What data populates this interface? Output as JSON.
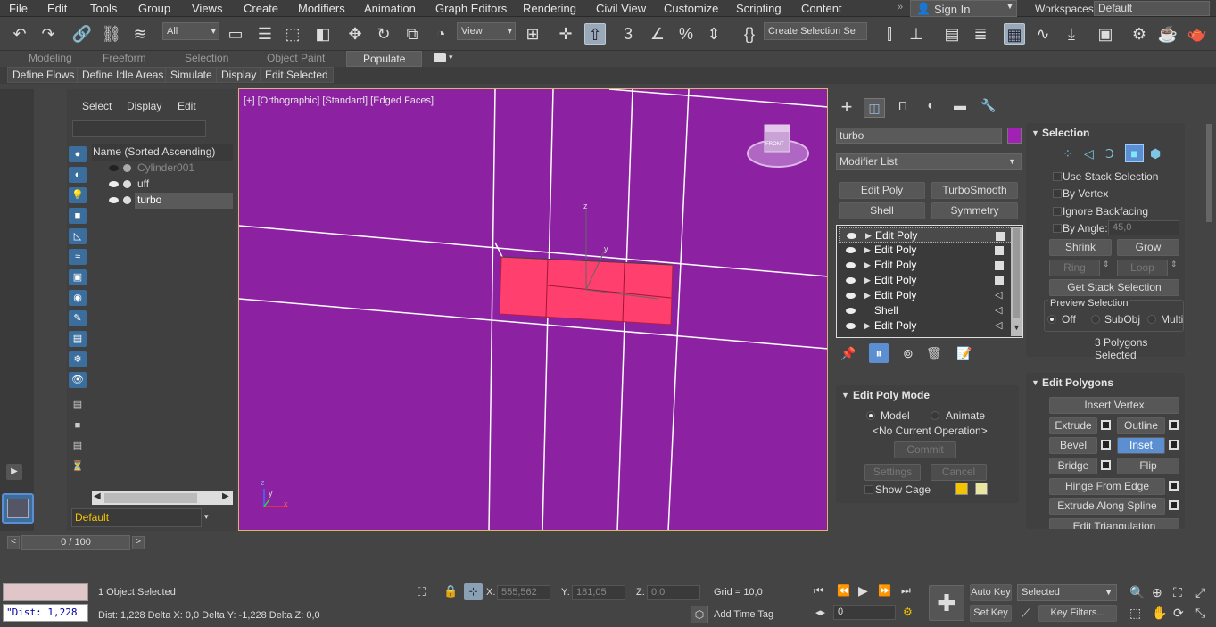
{
  "menubar": {
    "items": [
      "File",
      "Edit",
      "Tools",
      "Group",
      "Views",
      "Create",
      "Modifiers",
      "Animation",
      "Graph Editors",
      "Rendering",
      "Civil View",
      "Customize",
      "Scripting",
      "Content"
    ],
    "sign_in": "Sign In",
    "workspaces_label": "Workspaces:",
    "workspace_value": "Default"
  },
  "toolbar": {
    "selection_filter": "All",
    "reference_coord": "View",
    "named_selection": "Create Selection Se"
  },
  "ribbon": {
    "tabs": [
      "Modeling",
      "Freeform",
      "Selection",
      "Object Paint",
      "Populate"
    ],
    "active_tab": "Populate",
    "subtabs": [
      "Define Flows",
      "Define Idle Areas",
      "Simulate",
      "Display",
      "Edit Selected"
    ]
  },
  "scene_explorer": {
    "menu": [
      "Select",
      "Display",
      "Edit"
    ],
    "header": "Name (Sorted Ascending)",
    "rows": [
      {
        "name": "Cylinder001"
      },
      {
        "name": "uff"
      },
      {
        "name": "turbo"
      }
    ],
    "layer": "Default"
  },
  "viewport": {
    "label": "[+] [Orthographic] [Standard] [Edged Faces]",
    "bg_color": "#8c21a2",
    "object_color": "#ff3f6e",
    "viewcube_label": "FRONT",
    "axis_z": "z",
    "axis_y": "y",
    "axis_x": "x"
  },
  "command_panel": {
    "object_name": "turbo",
    "object_color": "#a021b4",
    "modifier_list": "Modifier List",
    "quick_buttons": [
      "Edit Poly",
      "TurboSmooth",
      "Shell",
      "Symmetry"
    ],
    "stack": [
      {
        "label": "Edit Poly",
        "eye": true,
        "arrow": true,
        "sel": true,
        "swatch": "square"
      },
      {
        "label": "Edit Poly",
        "eye": true,
        "arrow": true,
        "sel": false,
        "swatch": "square"
      },
      {
        "label": "Edit Poly",
        "eye": true,
        "arrow": true,
        "sel": false,
        "swatch": "square"
      },
      {
        "label": "Edit Poly",
        "eye": true,
        "arrow": true,
        "sel": false,
        "swatch": "square"
      },
      {
        "label": "Edit Poly",
        "eye": true,
        "arrow": true,
        "sel": false,
        "swatch": "tri"
      },
      {
        "label": "Shell",
        "eye": true,
        "arrow": false,
        "sel": false,
        "swatch": "tri"
      },
      {
        "label": "Edit Poly",
        "eye": true,
        "arrow": true,
        "sel": false,
        "swatch": "tri"
      }
    ],
    "edit_poly_mode": {
      "title": "Edit Poly Mode",
      "model": "Model",
      "animate": "Animate",
      "operation": "<No Current Operation>",
      "commit": "Commit",
      "settings": "Settings",
      "cancel": "Cancel",
      "show_cage": "Show Cage",
      "cage_color1": "#f5c400",
      "cage_color2": "#e8e6a0"
    }
  },
  "selection_rollout": {
    "title": "Selection",
    "use_stack": "Use Stack Selection",
    "by_vertex": "By Vertex",
    "ignore_backfacing": "Ignore Backfacing",
    "by_angle": "By Angle:",
    "angle_value": "45,0",
    "shrink": "Shrink",
    "grow": "Grow",
    "ring": "Ring",
    "loop": "Loop",
    "get_stack": "Get Stack Selection",
    "preview_title": "Preview Selection",
    "preview_off": "Off",
    "preview_subobj": "SubObj",
    "preview_multi": "Multi",
    "status": "3 Polygons Selected"
  },
  "edit_polygons": {
    "title": "Edit Polygons",
    "insert_vertex": "Insert Vertex",
    "extrude": "Extrude",
    "outline": "Outline",
    "bevel": "Bevel",
    "inset": "Inset",
    "bridge": "Bridge",
    "flip": "Flip",
    "hinge": "Hinge From Edge",
    "extrude_spline": "Extrude Along Spline",
    "edit_tri": "Edit Triangulation"
  },
  "timeline": {
    "frame": "0 / 100"
  },
  "status": {
    "selected": "1 Object Selected",
    "maxscript": "\"Dist: 1,228",
    "prompt": "Dist: 1,228 Delta X: 0,0 Delta Y: -1,228 Delta Z: 0,0",
    "x_label": "X:",
    "x_value": "555,562",
    "y_label": "Y:",
    "y_value": "181,05",
    "z_label": "Z:",
    "z_value": "0,0",
    "grid": "Grid = 10,0",
    "add_time_tag": "Add Time Tag",
    "auto_key": "Auto Key",
    "set_key": "Set Key",
    "key_filter_sel": "Selected",
    "key_filters": "Key Filters...",
    "current_frame": "0"
  }
}
